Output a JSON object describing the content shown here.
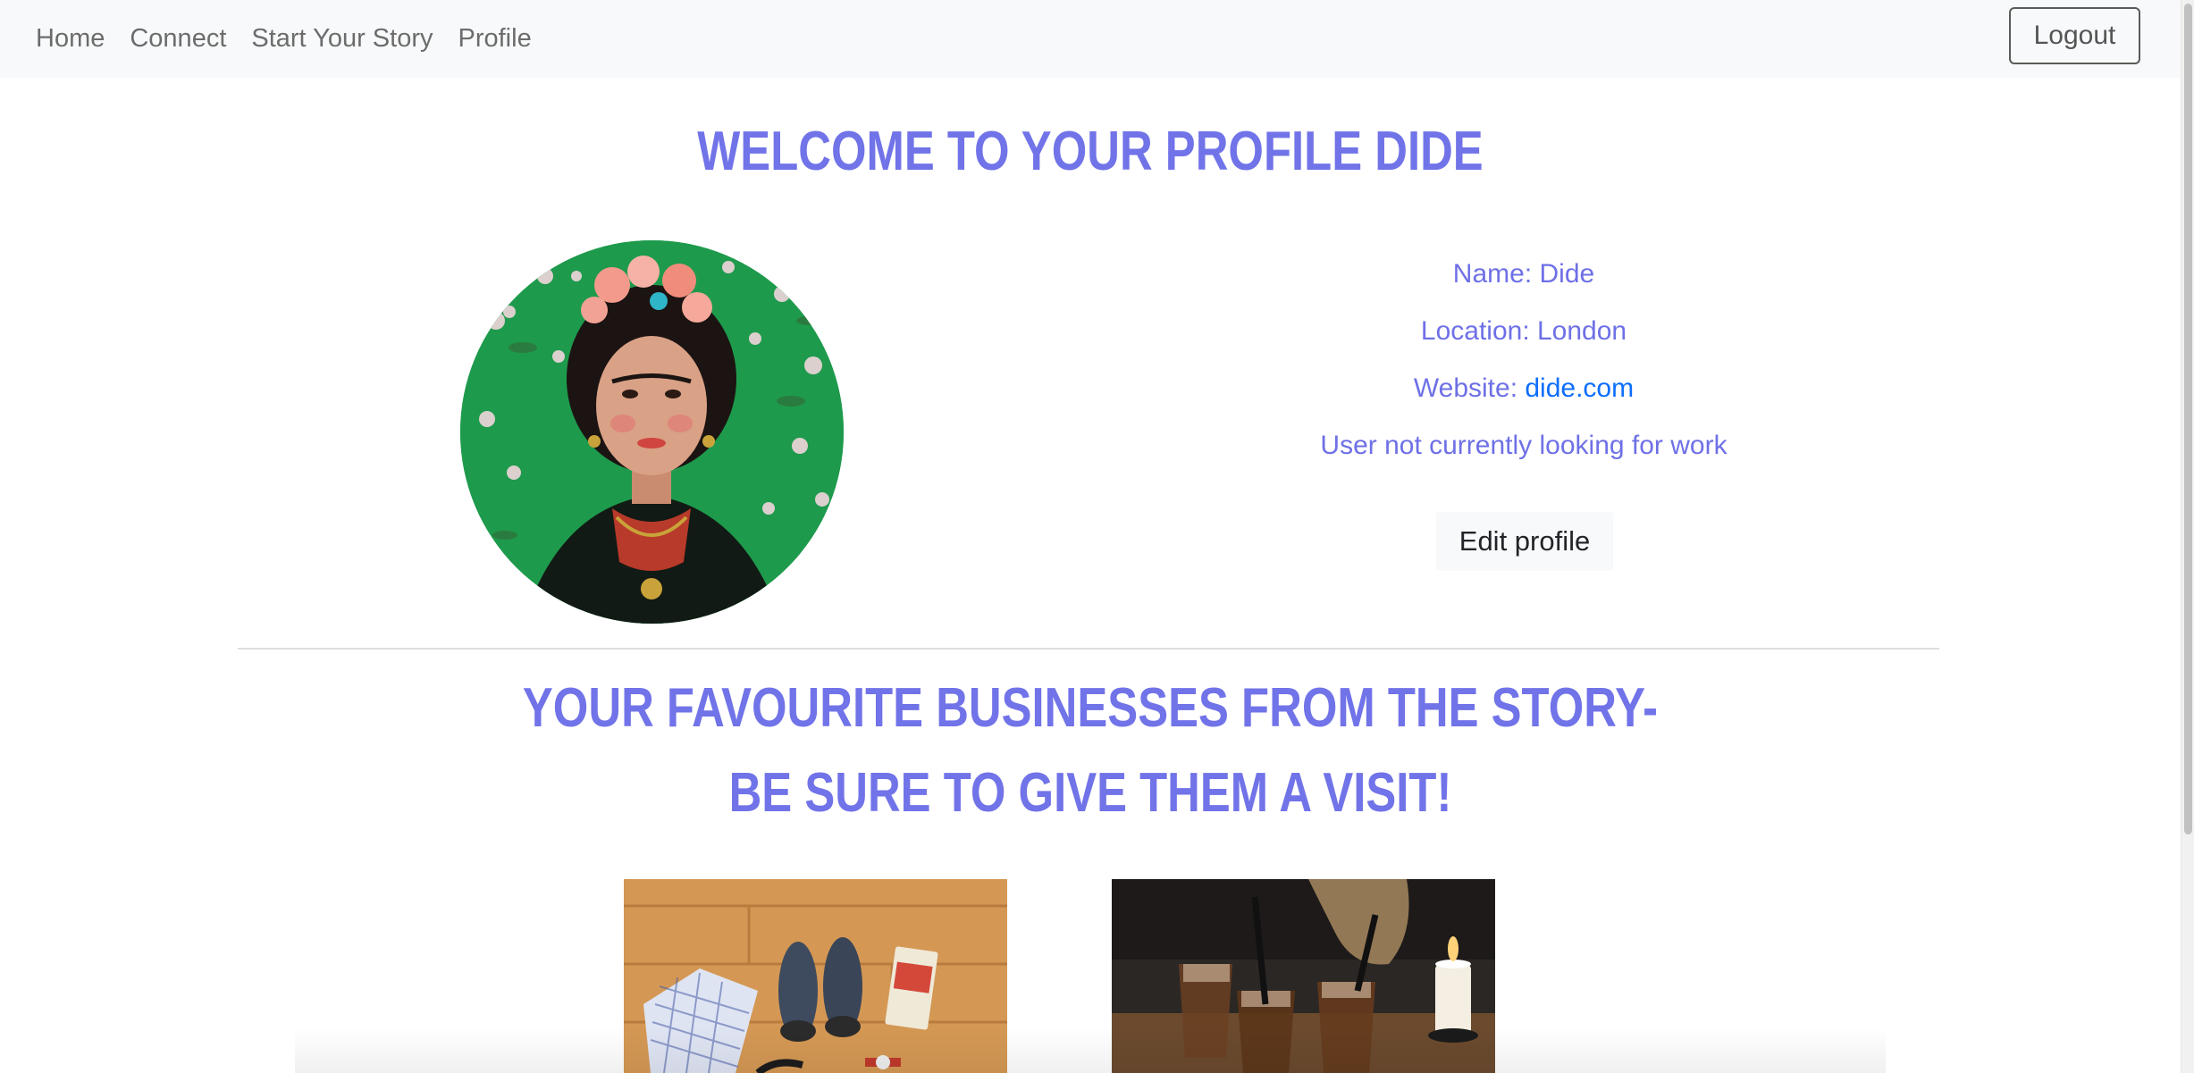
{
  "nav": {
    "links": [
      "Home",
      "Connect",
      "Start Your Story",
      "Profile"
    ],
    "logout_label": "Logout"
  },
  "profile": {
    "title": "Welcome to your profile Dide",
    "name_line": "Name: Dide",
    "location_line": "Location: London",
    "website_prefix": "Website: ",
    "website_link": "dide.com",
    "work_status": "User not currently looking for work",
    "edit_label": "Edit profile"
  },
  "favourites": {
    "heading_line1": "Your favourite businesses from the story-",
    "heading_line2": "be sure to give them a visit!"
  },
  "colors": {
    "accent": "#7173e8",
    "link": "#0d6efd",
    "navbar_bg": "#f8f9fa"
  }
}
